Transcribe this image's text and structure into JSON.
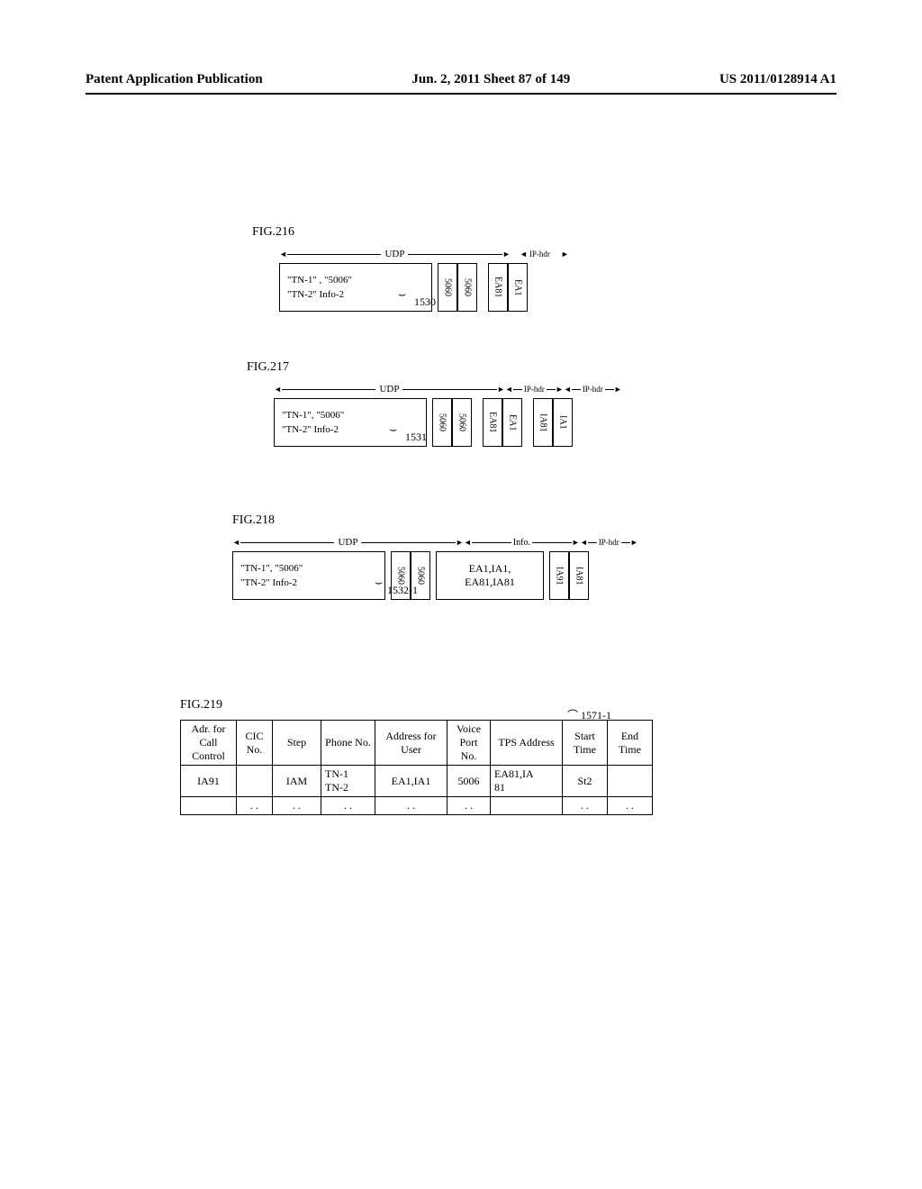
{
  "header": {
    "left": "Patent Application Publication",
    "center": "Jun. 2, 2011  Sheet 87 of 149",
    "right": "US 2011/0128914 A1"
  },
  "fig216": {
    "label": "FIG.216",
    "udp": "UDP",
    "iphdr": "IP-hdr",
    "payload_l1": "\"TN-1\" ,  \"5006\"",
    "payload_l2": "\"TN-2\"   Info-2",
    "port1": "5060",
    "port2": "5060",
    "addr1": "EA81",
    "addr2": "EA1",
    "ref": "1530"
  },
  "fig217": {
    "label": "FIG.217",
    "udp": "UDP",
    "iphdr": "IP-hdr",
    "payload_l1": "\"TN-1\",  \"5006\"",
    "payload_l2": "\"TN-2\"   Info-2",
    "port1": "5060",
    "port2": "5060",
    "addr1": "EA81",
    "addr2": "EA1",
    "addr3": "IA81",
    "addr4": "IA1",
    "ref": "1531"
  },
  "fig218": {
    "label": "FIG.218",
    "udp": "UDP",
    "info": "Info.",
    "iphdr": "IP-hdr",
    "payload_l1": "\"TN-1\",  \"5006\"",
    "payload_l2": "\"TN-2\"   Info-2",
    "port1": "5060",
    "port2": "5060",
    "info_l1": "EA1,IA1,",
    "info_l2": "EA81,IA81",
    "addr1": "IA91",
    "addr2": "IA81",
    "ref": "1532-1"
  },
  "fig219": {
    "label": "FIG.219",
    "ref": "1571-1",
    "headers": [
      "Adr. for Call Control",
      "CIC No.",
      "Step",
      "Phone No.",
      "Address for User",
      "Voice Port No.",
      "TPS Address",
      "Start Time",
      "End Time"
    ],
    "row1": {
      "c0": "IA91",
      "c1": "",
      "c2": "IAM",
      "c3_l1": "TN-1",
      "c3_l2": "TN-2",
      "c4": "EA1,IA1",
      "c5": "5006",
      "c6_l1": "EA81,IA",
      "c6_l2": "81",
      "c7": "St2",
      "c8": ""
    },
    "row2": {
      "c0": "",
      "c1": ". .",
      "c2": ". .",
      "c3": ". .",
      "c4": ". .",
      "c5": ". .",
      "c6": "",
      "c7": ". .",
      "c8": ". ."
    }
  }
}
